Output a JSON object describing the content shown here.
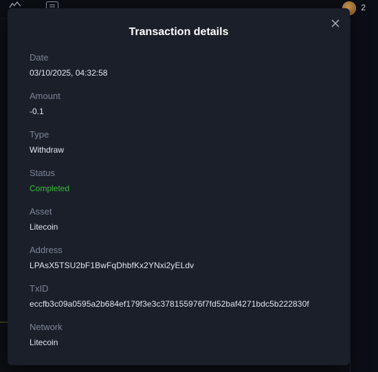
{
  "modal": {
    "title": "Transaction details",
    "close_icon": "close-icon"
  },
  "fields": [
    {
      "key": "date",
      "label": "Date",
      "value": "03/10/2025, 04:32:58"
    },
    {
      "key": "amount",
      "label": "Amount",
      "value": "-0.1"
    },
    {
      "key": "type",
      "label": "Type",
      "value": "Withdraw"
    },
    {
      "key": "status",
      "label": "Status",
      "value": "Completed",
      "color": "#3bbf3b"
    },
    {
      "key": "asset",
      "label": "Asset",
      "value": "Litecoin"
    },
    {
      "key": "address",
      "label": "Address",
      "value": "LPAsX5TSU2bF1BwFqDhbfKx2YNxi2yELdv"
    },
    {
      "key": "txid",
      "label": "TxID",
      "value": "eccfb3c09a0595a2b684ef179f3e3c378155976f7fd52baf4271bdc5b222830f"
    },
    {
      "key": "network",
      "label": "Network",
      "value": "Litecoin"
    }
  ],
  "background": {
    "top_icons": [
      "chart-icon",
      "document-icon"
    ],
    "avatar_text": "2"
  },
  "colors": {
    "modal_bg": "#1b1f2a",
    "label": "#7d8596",
    "value": "#e3e7ee",
    "success": "#3bbf3b"
  }
}
